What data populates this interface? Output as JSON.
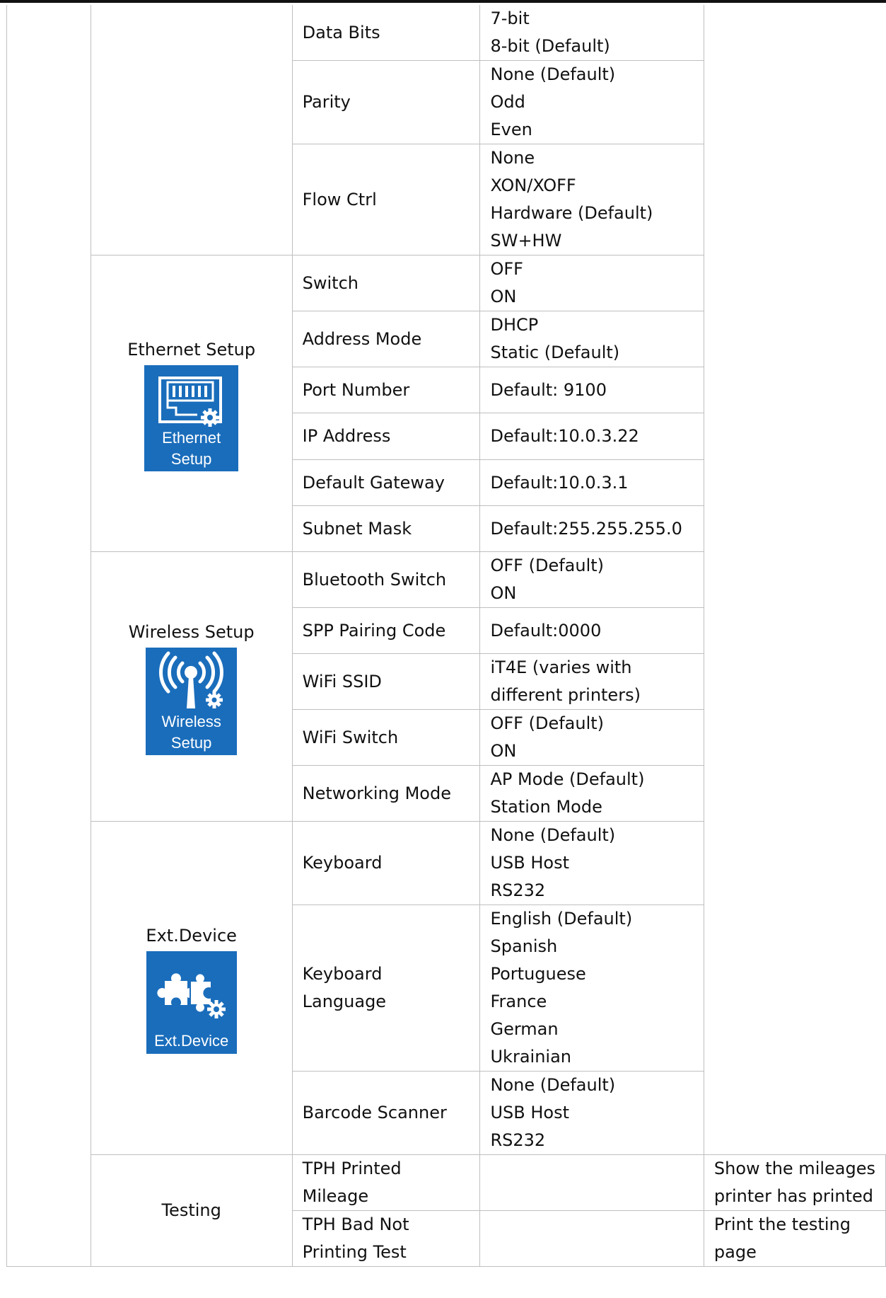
{
  "rows": [
    {
      "setting": "Data Bits",
      "options": [
        "7-bit",
        "8-bit (Default)"
      ]
    },
    {
      "setting": "Parity",
      "options": [
        "None (Default)",
        "Odd",
        "Even"
      ]
    },
    {
      "setting": "Flow Ctrl",
      "options": [
        "None",
        "XON/XOFF",
        "Hardware (Default)",
        "SW+HW"
      ]
    },
    {
      "setting": "Switch",
      "options": [
        "OFF",
        "ON"
      ]
    },
    {
      "setting": "Address Mode",
      "options": [
        "DHCP",
        "Static (Default)"
      ]
    },
    {
      "setting": "Port Number",
      "options": [
        "Default: 9100"
      ]
    },
    {
      "setting": "IP Address",
      "options": [
        "Default:10.0.3.22"
      ]
    },
    {
      "setting": "Default Gateway",
      "options": [
        "Default:10.0.3.1"
      ]
    },
    {
      "setting": "Subnet Mask",
      "options": [
        "Default:255.255.255.0"
      ]
    },
    {
      "setting": "Bluetooth Switch",
      "options": [
        "OFF (Default)",
        "ON"
      ]
    },
    {
      "setting": "SPP Pairing Code",
      "options": [
        "Default:0000"
      ]
    },
    {
      "setting": "WiFi SSID",
      "options": [
        "iT4E (varies with",
        "different printers)"
      ]
    },
    {
      "setting": "WiFi Switch",
      "options": [
        "OFF (Default)",
        "ON"
      ]
    },
    {
      "setting": "Networking Mode",
      "options": [
        "AP Mode (Default)",
        "Station Mode"
      ]
    },
    {
      "setting": "Keyboard",
      "options": [
        "None (Default)",
        "USB Host",
        "RS232"
      ]
    },
    {
      "setting": "Keyboard Language",
      "options": [
        "English (Default)",
        "Spanish",
        "Portuguese",
        "France",
        "German",
        "Ukrainian"
      ]
    },
    {
      "setting": "Barcode Scanner",
      "options": [
        "None (Default)",
        "USB Host",
        "RS232"
      ]
    }
  ],
  "menus": {
    "ethernet": {
      "title": "Ethernet Setup",
      "icon": "ethernet-port-gear-icon",
      "icon_caption": [
        "Ethernet",
        "Setup"
      ]
    },
    "wireless": {
      "title": "Wireless Setup",
      "icon": "antenna-signal-gear-icon",
      "icon_caption": [
        "Wireless",
        "Setup"
      ]
    },
    "ext_device": {
      "title": "Ext.Device",
      "icon": "puzzle-gear-icon",
      "icon_caption": [
        "Ext.Device"
      ]
    }
  },
  "testing": {
    "group": "Testing",
    "items": [
      {
        "item": "TPH Printed Mileage",
        "description": [
          "Show the mileages",
          "printer has printed"
        ]
      },
      {
        "item": "TPH Bad Not Printing Test",
        "description": [
          "Print the testing page"
        ]
      }
    ]
  },
  "colors": {
    "icon_background": "#1a6dbb",
    "icon_foreground": "#ffffff",
    "grid": "#bfbfbf"
  }
}
